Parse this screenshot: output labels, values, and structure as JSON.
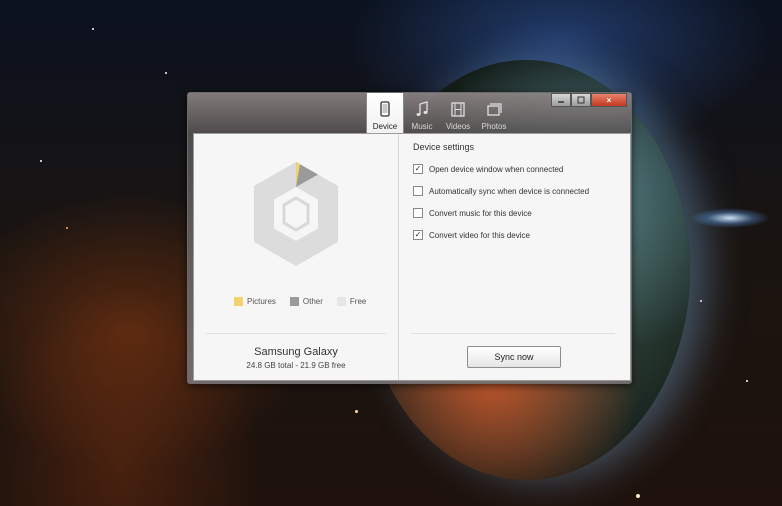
{
  "window": {
    "tabs": [
      {
        "label": "Device",
        "icon": "phone-icon",
        "active": true
      },
      {
        "label": "Music",
        "icon": "music-note-icon",
        "active": false
      },
      {
        "label": "Videos",
        "icon": "film-icon",
        "active": false
      },
      {
        "label": "Photos",
        "icon": "photos-icon",
        "active": false
      }
    ],
    "controls": {
      "minimize": "minimize-icon",
      "maximize": "maximize-icon",
      "close": "×"
    }
  },
  "device_panel": {
    "legend": [
      {
        "label": "Pictures",
        "color": "#f2d26b"
      },
      {
        "label": "Other",
        "color": "#9a9a9a"
      },
      {
        "label": "Free",
        "color": "#e6e6e6"
      }
    ],
    "device_name": "Samsung Galaxy",
    "capacity_text": "24.8 GB total - 21.9 GB free"
  },
  "settings_panel": {
    "title": "Device settings",
    "options": [
      {
        "label": "Open device window when connected",
        "checked": true,
        "mark": "✓"
      },
      {
        "label": "Automatically sync when device is connected",
        "checked": false,
        "mark": ""
      },
      {
        "label": "Convert music for this device",
        "checked": false,
        "mark": ""
      },
      {
        "label": "Convert video for this device",
        "checked": true,
        "mark": "✓"
      }
    ],
    "sync_button": "Sync now"
  }
}
